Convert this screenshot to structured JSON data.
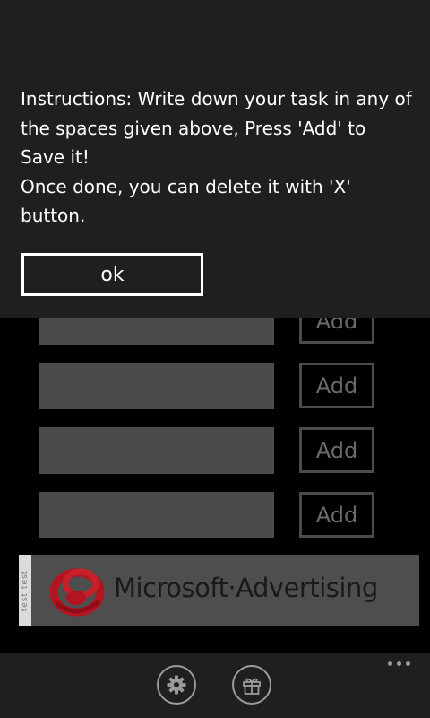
{
  "tasks": [
    {
      "value": "",
      "add_label": "Add"
    },
    {
      "value": "",
      "add_label": "Add"
    },
    {
      "value": "",
      "add_label": "Add"
    },
    {
      "value": "",
      "add_label": "Add"
    }
  ],
  "ad": {
    "test_label": "test test",
    "text": "Microsoft·Advertising"
  },
  "dialog": {
    "line1": "Instructions: Write down your task in any of the spaces given above, Press 'Add' to Save it!",
    "line2": "Once done, you can delete it with 'X' button.",
    "ok_label": "ok"
  },
  "app_bar": {
    "buttons": [
      {
        "icon": "gear-icon"
      },
      {
        "icon": "gift-icon"
      }
    ]
  },
  "colors": {
    "background": "#000000",
    "dialog_background": "#1f1f1f",
    "input_fill": "#4b4b4b",
    "logo_red": "#b3141f",
    "ad_background": "#4e4e4e"
  }
}
